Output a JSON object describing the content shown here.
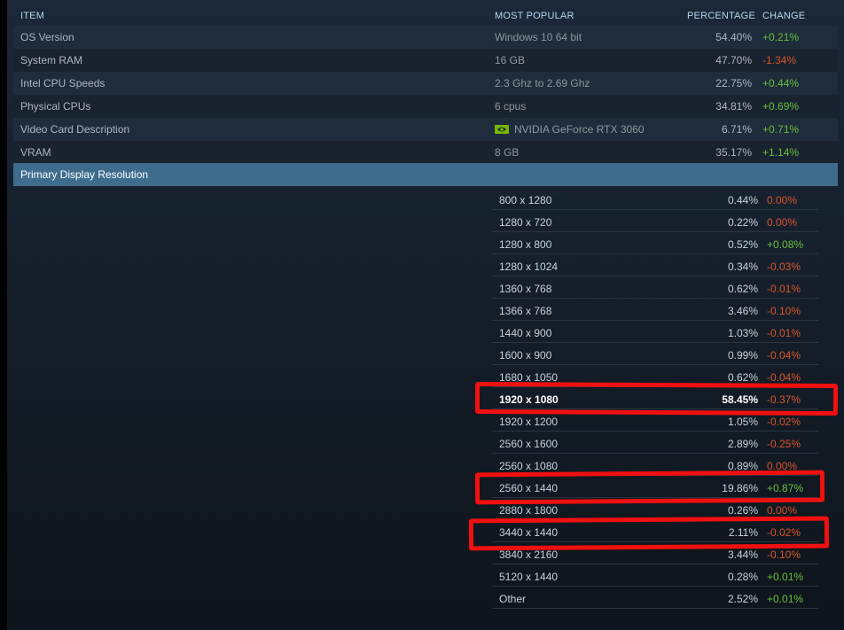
{
  "header": {
    "item": "ITEM",
    "most_popular": "MOST POPULAR",
    "percentage": "PERCENTAGE",
    "change": "CHANGE"
  },
  "rows": [
    {
      "name": "OS Version",
      "popular": "Windows 10 64 bit",
      "percentage": "54.40%",
      "change": "+0.21%"
    },
    {
      "name": "System RAM",
      "popular": "16 GB",
      "percentage": "47.70%",
      "change": "-1.34%"
    },
    {
      "name": "Intel CPU Speeds",
      "popular": "2.3 Ghz to 2.69 Ghz",
      "percentage": "22.75%",
      "change": "+0.44%"
    },
    {
      "name": "Physical CPUs",
      "popular": "6 cpus",
      "percentage": "34.81%",
      "change": "+0.69%"
    },
    {
      "name": "Video Card Description",
      "popular": "NVIDIA GeForce RTX 3060",
      "popular_icon": "nvidia-logo-icon",
      "percentage": "6.71%",
      "change": "+0.71%"
    },
    {
      "name": "VRAM",
      "popular": "8 GB",
      "percentage": "35.17%",
      "change": "+1.14%"
    }
  ],
  "section": {
    "title": "Primary Display Resolution"
  },
  "resolutions": [
    {
      "res": "800 x 1280",
      "percentage": "0.44%",
      "change": "0.00%"
    },
    {
      "res": "1280 x 720",
      "percentage": "0.22%",
      "change": "0.00%"
    },
    {
      "res": "1280 x 800",
      "percentage": "0.52%",
      "change": "+0.08%"
    },
    {
      "res": "1280 x 1024",
      "percentage": "0.34%",
      "change": "-0.03%"
    },
    {
      "res": "1360 x 768",
      "percentage": "0.62%",
      "change": "-0.01%"
    },
    {
      "res": "1366 x 768",
      "percentage": "3.46%",
      "change": "-0.10%"
    },
    {
      "res": "1440 x 900",
      "percentage": "1.03%",
      "change": "-0.01%"
    },
    {
      "res": "1600 x 900",
      "percentage": "0.99%",
      "change": "-0.04%"
    },
    {
      "res": "1680 x 1050",
      "percentage": "0.62%",
      "change": "-0.04%"
    },
    {
      "res": "1920 x 1080",
      "percentage": "58.45%",
      "change": "-0.37%"
    },
    {
      "res": "1920 x 1200",
      "percentage": "1.05%",
      "change": "-0.02%"
    },
    {
      "res": "2560 x 1600",
      "percentage": "2.89%",
      "change": "-0.25%"
    },
    {
      "res": "2560 x 1080",
      "percentage": "0.89%",
      "change": "0.00%"
    },
    {
      "res": "2560 x 1440",
      "percentage": "19.86%",
      "change": "+0.87%"
    },
    {
      "res": "2880 x 1800",
      "percentage": "0.26%",
      "change": "0.00%"
    },
    {
      "res": "3440 x 1440",
      "percentage": "2.11%",
      "change": "-0.02%"
    },
    {
      "res": "3840 x 2160",
      "percentage": "3.44%",
      "change": "-0.10%"
    },
    {
      "res": "5120 x 1440",
      "percentage": "0.28%",
      "change": "+0.01%"
    },
    {
      "res": "Other",
      "percentage": "2.52%",
      "change": "+0.01%"
    }
  ],
  "colors": {
    "positive": "#66c03a",
    "negative": "#d9562b",
    "section_bg": "#3d6c8d",
    "highlight": "#f01010"
  }
}
